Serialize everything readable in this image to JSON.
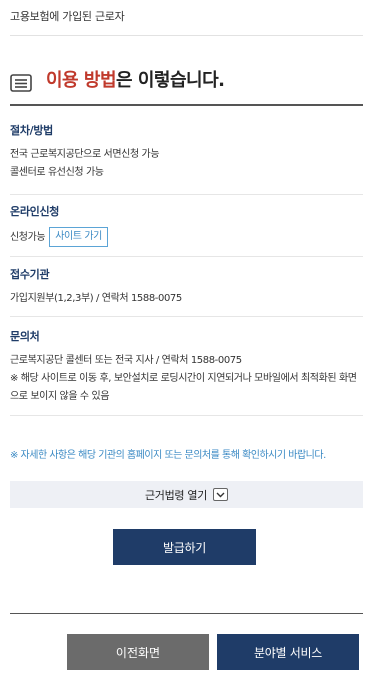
{
  "top": {
    "text": "고용보험에 가입된 근로자"
  },
  "howto": {
    "icon": "list-icon",
    "accent": "이용 방법",
    "rest": "은 이렇습니다."
  },
  "sections": [
    {
      "heading": "절차/방법",
      "lines": [
        "전국 근로복지공단으로 서면신청 가능",
        "콜센터로 유선신청 가능"
      ]
    },
    {
      "heading": "온라인신청",
      "lines": [
        "신청가능"
      ],
      "button": "사이트 가기"
    },
    {
      "heading": "접수기관",
      "lines": [
        "가입지원부(1,2,3부) / 연락처 1588-0075"
      ]
    },
    {
      "heading": "문의처",
      "lines": [
        "근로복지공단 콜센터 또는 전국 지사 / 연락처 1588-0075",
        "※ 해당 사이트로 이동 후, 보안설치로 로딩시간이 지연되거나 모바일에서 최적화된 화면으로 보이지 않을 수 있음"
      ]
    }
  ],
  "notice": "※ 자세한 사항은 해당 기관의 홈페이지 또는 문의처를 통해 확인하시기 바랍니다.",
  "law": {
    "label": "근거법령 열기",
    "icon": "chevron-down-icon"
  },
  "buttons": {
    "issue": "발급하기",
    "prev": "이전화면",
    "field": "분야별 서비스"
  }
}
